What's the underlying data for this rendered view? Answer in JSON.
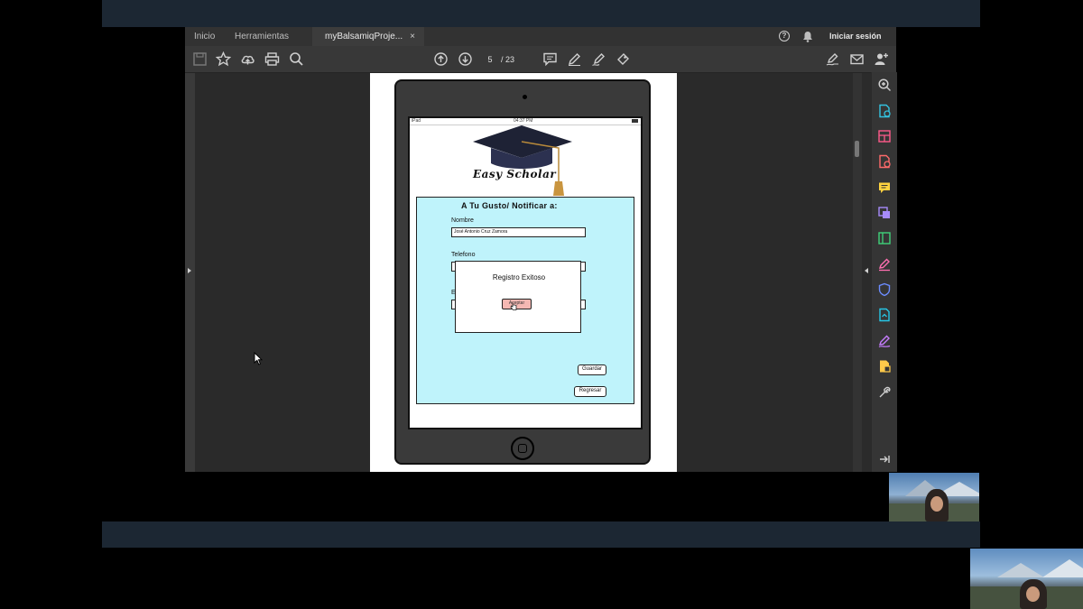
{
  "app": {
    "tabs": [
      {
        "label": "Inicio"
      },
      {
        "label": "Herramientas"
      },
      {
        "label": "myBalsamiqProje..."
      }
    ],
    "tab_close": "×",
    "sign_in": "Iniciar sesión",
    "help_icon": "?",
    "page": {
      "current": "5",
      "total": "/ 23"
    }
  },
  "mockup": {
    "statusbar": {
      "left": "iPad",
      "center": "04:37 PM"
    },
    "logo_text": "Easy Scholar",
    "form_title": "A Tu Gusto/ Notificar a:",
    "fields": {
      "nombre_label": "Nombre",
      "nombre_value": "José Antonio Cruz Zamora",
      "telefono_label": "Telefono",
      "email_label_fragment": "E"
    },
    "modal": {
      "title": "Registro Exitoso",
      "button": "Aceptar"
    },
    "buttons": {
      "guardar": "Guardar",
      "regresar": "Regresar"
    }
  },
  "colors": {
    "form_bg": "#bff3fb",
    "modal_button": "#f5b8b3",
    "right_panel_icons": [
      "#9fb8ff",
      "#34c3e0",
      "#ff5a8a",
      "#ff6b6b",
      "#ffd23f",
      "#a78bfa",
      "#3fd27a",
      "#ff6fb0",
      "#6c8cff",
      "#27c6e6",
      "#c77dff",
      "#ffc94a",
      "#cfcfcf"
    ]
  }
}
